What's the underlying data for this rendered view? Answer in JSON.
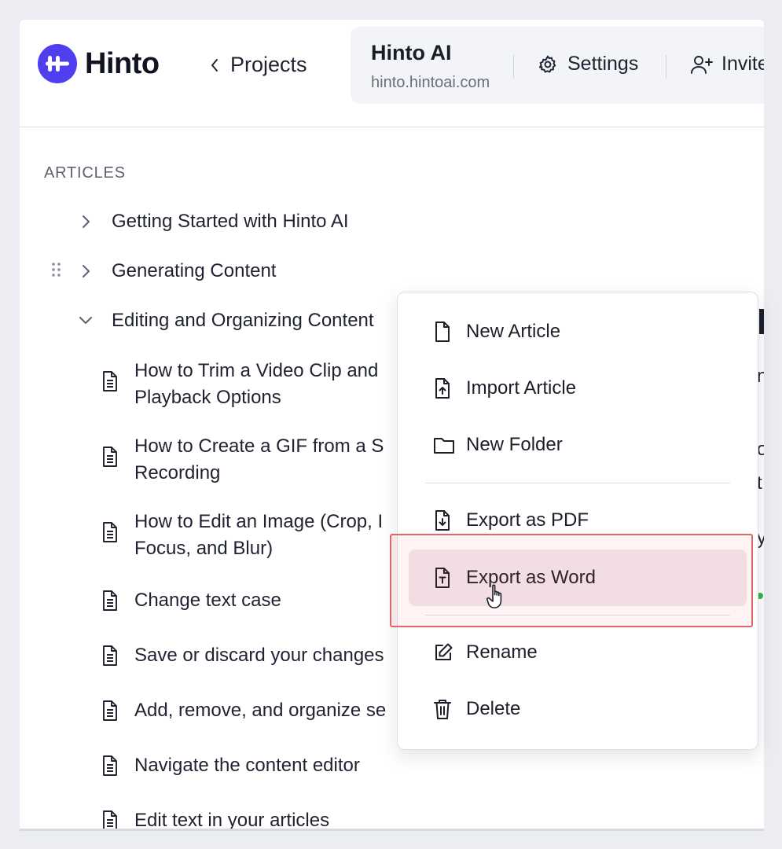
{
  "header": {
    "logo_text": "Hinto",
    "back_label": "Projects",
    "project_name": "Hinto AI",
    "project_domain": "hinto.hintoai.com",
    "settings_label": "Settings",
    "invite_label": "Invite"
  },
  "sidebar": {
    "section_title": "ARTICLES",
    "items": [
      {
        "label": "Getting Started with Hinto AI",
        "state": "collapsed"
      },
      {
        "label": "Generating Content",
        "state": "collapsed"
      },
      {
        "label": "Editing and Organizing Content",
        "state": "expanded"
      }
    ],
    "articles": [
      {
        "line1": "How to Trim a Video Clip and",
        "line2": "Playback Options"
      },
      {
        "line1": "How to Create a GIF from a S",
        "line2": "Recording"
      },
      {
        "line1": "How to Edit an Image (Crop, I",
        "line2": "Focus, and Blur)"
      },
      {
        "line1": "Change text case"
      },
      {
        "line1": "Save or discard your changes"
      },
      {
        "line1": "Add, remove, and organize se"
      },
      {
        "line1": "Navigate the content editor"
      },
      {
        "line1": "Edit text in your articles"
      }
    ]
  },
  "context_menu": {
    "items": [
      {
        "label": "New Article",
        "icon": "file-icon"
      },
      {
        "label": "Import Article",
        "icon": "file-upload-icon"
      },
      {
        "label": "New Folder",
        "icon": "folder-icon"
      },
      {
        "label": "Export as PDF",
        "icon": "file-download-icon"
      },
      {
        "label": "Export as Word",
        "icon": "file-text-icon",
        "active": true
      },
      {
        "label": "Rename",
        "icon": "pencil-square-icon"
      },
      {
        "label": "Delete",
        "icon": "trash-icon"
      }
    ]
  },
  "edge_fragments": [
    "n",
    "o",
    "t",
    "y"
  ],
  "colors": {
    "brand": "#4f3ff0",
    "highlight_border": "#e06767",
    "menu_active": "#f1e8ee",
    "status_green": "#2fb84e"
  }
}
